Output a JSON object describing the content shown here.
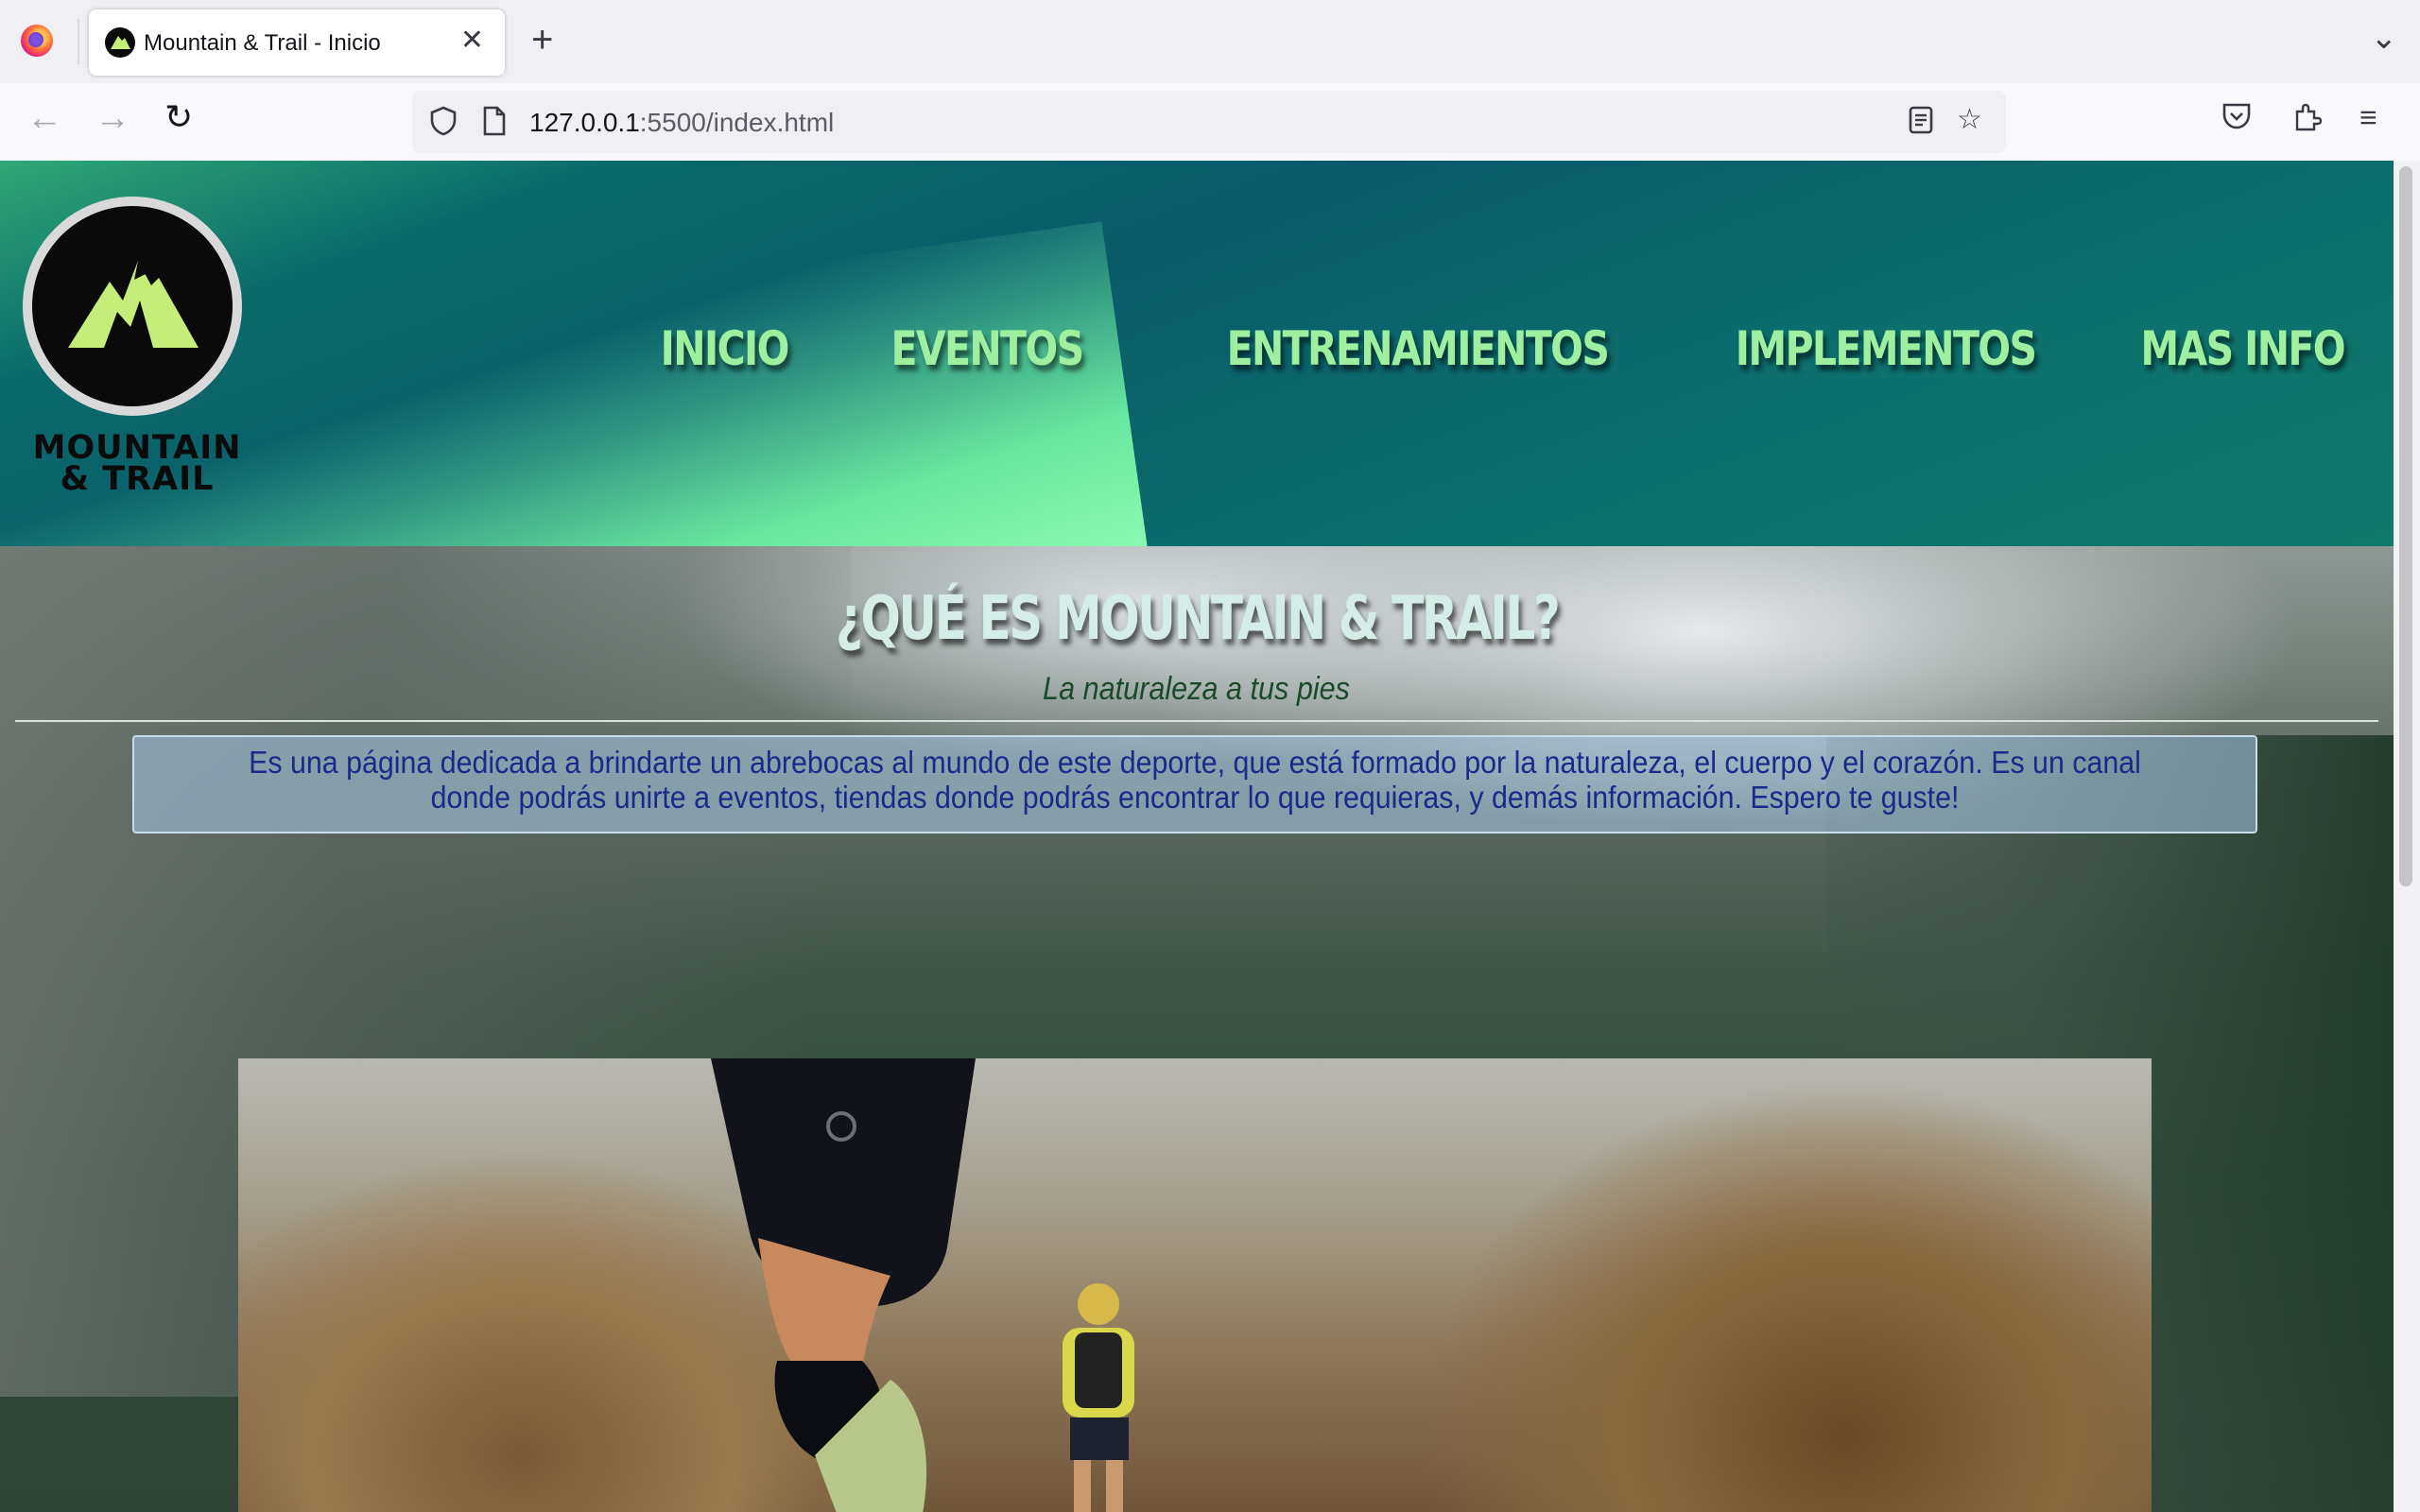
{
  "browser": {
    "tab_title": "Mountain & Trail - Inicio",
    "url_host": "127.0.0.1",
    "url_path": ":5500/index.html"
  },
  "site": {
    "logo_text_line1": "MOUNTAIN",
    "logo_text_line2": "& TRAIL",
    "nav": [
      "INICIO",
      "EVENTOS",
      "ENTRENAMIENTOS",
      "IMPLEMENTOS",
      "MAS INFO"
    ],
    "accent_color": "#9ef0a0"
  },
  "hero": {
    "title": "¿QUÉ ES MOUNTAIN & TRAIL?",
    "subtitle": "La naturaleza a tus pies",
    "intro": "Es una página dedicada a brindarte un abrebocas al mundo de este deporte, que está formado por la naturaleza, el cuerpo y el corazón. Es un canal donde podrás unirte a eventos, tiendas donde podrás encontrar lo que requieras, y demás información. Espero te guste!"
  }
}
